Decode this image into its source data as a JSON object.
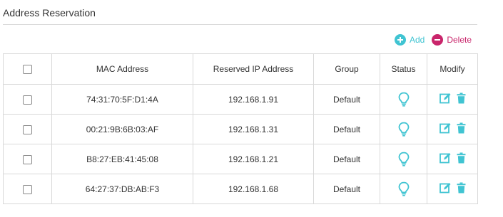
{
  "page": {
    "title": "Address Reservation"
  },
  "toolbar": {
    "add_label": "Add",
    "delete_label": "Delete"
  },
  "table": {
    "columns": [
      "MAC Address",
      "Reserved IP Address",
      "Group",
      "Status",
      "Modify"
    ],
    "rows": [
      {
        "mac": "74:31:70:5F:D1:4A",
        "ip": "192.168.1.91",
        "group": "Default",
        "status_icon": "lightbulb-icon",
        "status": "enabled"
      },
      {
        "mac": "00:21:9B:6B:03:AF",
        "ip": "192.168.1.31",
        "group": "Default",
        "status_icon": "lightbulb-icon",
        "status": "enabled"
      },
      {
        "mac": "B8:27:EB:41:45:08",
        "ip": "192.168.1.21",
        "group": "Default",
        "status_icon": "lightbulb-icon",
        "status": "enabled"
      },
      {
        "mac": "64:27:37:DB:AB:F3",
        "ip": "192.168.1.68",
        "group": "Default",
        "status_icon": "lightbulb-icon",
        "status": "enabled"
      }
    ]
  },
  "colors": {
    "accent": "#40c4d2",
    "delete": "#c9256b",
    "border": "#d9d9d9",
    "text": "#333333"
  }
}
